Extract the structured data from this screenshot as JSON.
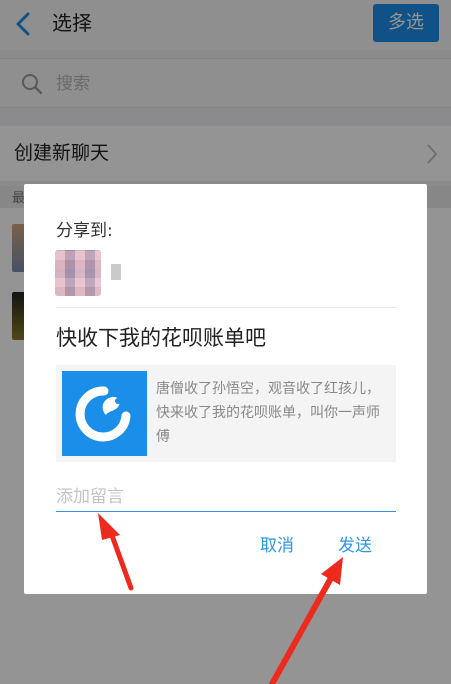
{
  "header": {
    "title": "选择",
    "multi_select_label": "多选"
  },
  "search": {
    "placeholder": "搜索"
  },
  "new_chat": {
    "label": "创建新聊天"
  },
  "section": {
    "label": "最"
  },
  "dialog": {
    "share_to": "分享到:",
    "message_title": "快收下我的花呗账单吧",
    "card_text": "唐僧收了孙悟空，观音收了红孩儿，快来收了我的花呗账单，叫你一声师傅",
    "comment_placeholder": "添加留言",
    "cancel_label": "取消",
    "send_label": "发送"
  },
  "colors": {
    "accent": "#1c8ee8",
    "annotation_arrow": "#ee2a1f"
  }
}
